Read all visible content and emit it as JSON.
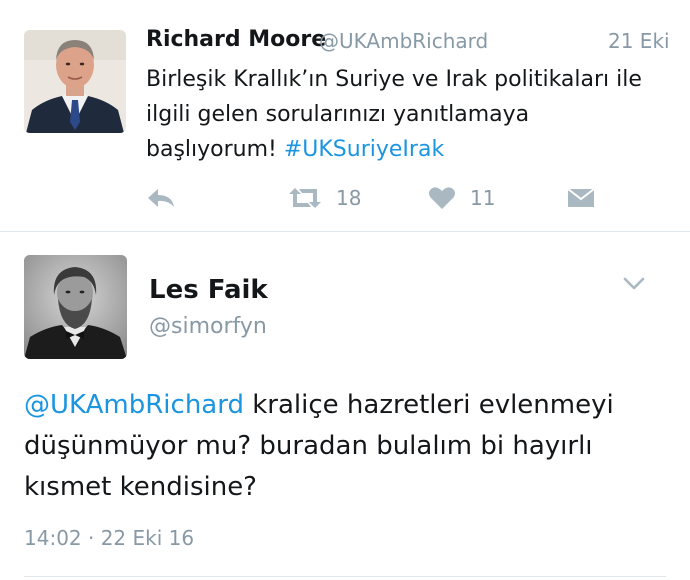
{
  "tweet1": {
    "name": "Richard Moore",
    "handle": "@UKAmbRichard",
    "date": "21 Eki",
    "text_main": "Birleşik Krallık’ın Suriye ve Irak politikaları ile ilgili gelen sorularınızı yanıtlamaya başlıyorum! ",
    "hashtag": "#UKSuriyeIrak",
    "retweet_count": "18",
    "like_count": "11",
    "icons": [
      "reply-icon",
      "retweet-icon",
      "heart-icon",
      "envelope-icon"
    ]
  },
  "tweet2": {
    "name": "Les Faik",
    "handle": "@simorfyn",
    "mention": "@UKAmbRichard",
    "text_main": " kraliçe hazretleri evlenmeyi düşünmüyor mu? buradan bulalım bi hayırlı kısmet kendisine?",
    "timestamp": "14:02 · 22 Eki 16",
    "icons": [
      "chevron-down-icon"
    ]
  },
  "colors": {
    "link": "#1b95e0",
    "secondary_text": "#8899a6",
    "action_icon": "#aab8c2",
    "divider": "#e1e8ed"
  }
}
